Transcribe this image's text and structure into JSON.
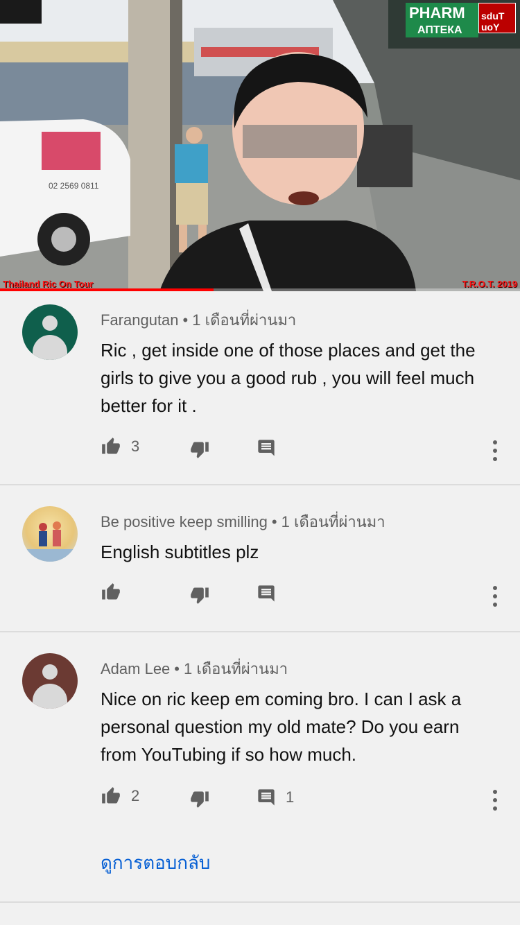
{
  "video": {
    "watermark_left": "Thailand Ric On Tour",
    "watermark_right": "T.R.O.T. 2019",
    "shop_sign": "PHARM",
    "shop_sign_sub": "АПТЕКА",
    "badge_text": "sduT uoY",
    "van_phone": "02 2569 0811",
    "progress_percent": 41
  },
  "comments": [
    {
      "author": "Farangutan",
      "time": "1 เดือนที่ผ่านมา",
      "text": "Ric , get inside one of those places and get the girls to give you a good rub , you will feel much better for it .",
      "likes": "3",
      "replies": "",
      "avatar_color": "#0f5f4c",
      "avatar_type": "default"
    },
    {
      "author": "Be positive keep smilling",
      "time": "1 เดือนที่ผ่านมา",
      "text": "English subtitles plz",
      "likes": "",
      "replies": "",
      "avatar_color": "#e4c98a",
      "avatar_type": "photo"
    },
    {
      "author": "Adam Lee",
      "time": "1 เดือนที่ผ่านมา",
      "text": "Nice on ric keep em coming bro. I can I ask a personal question my old mate?  Do you earn from YouTubing if so how much.",
      "likes": "2",
      "replies": "1",
      "avatar_color": "#6b3a33",
      "avatar_type": "default"
    }
  ],
  "view_replies_label": "ดูการตอบกลับ",
  "icons": [
    "like-icon",
    "dislike-icon",
    "reply-icon",
    "more-vert-icon"
  ]
}
